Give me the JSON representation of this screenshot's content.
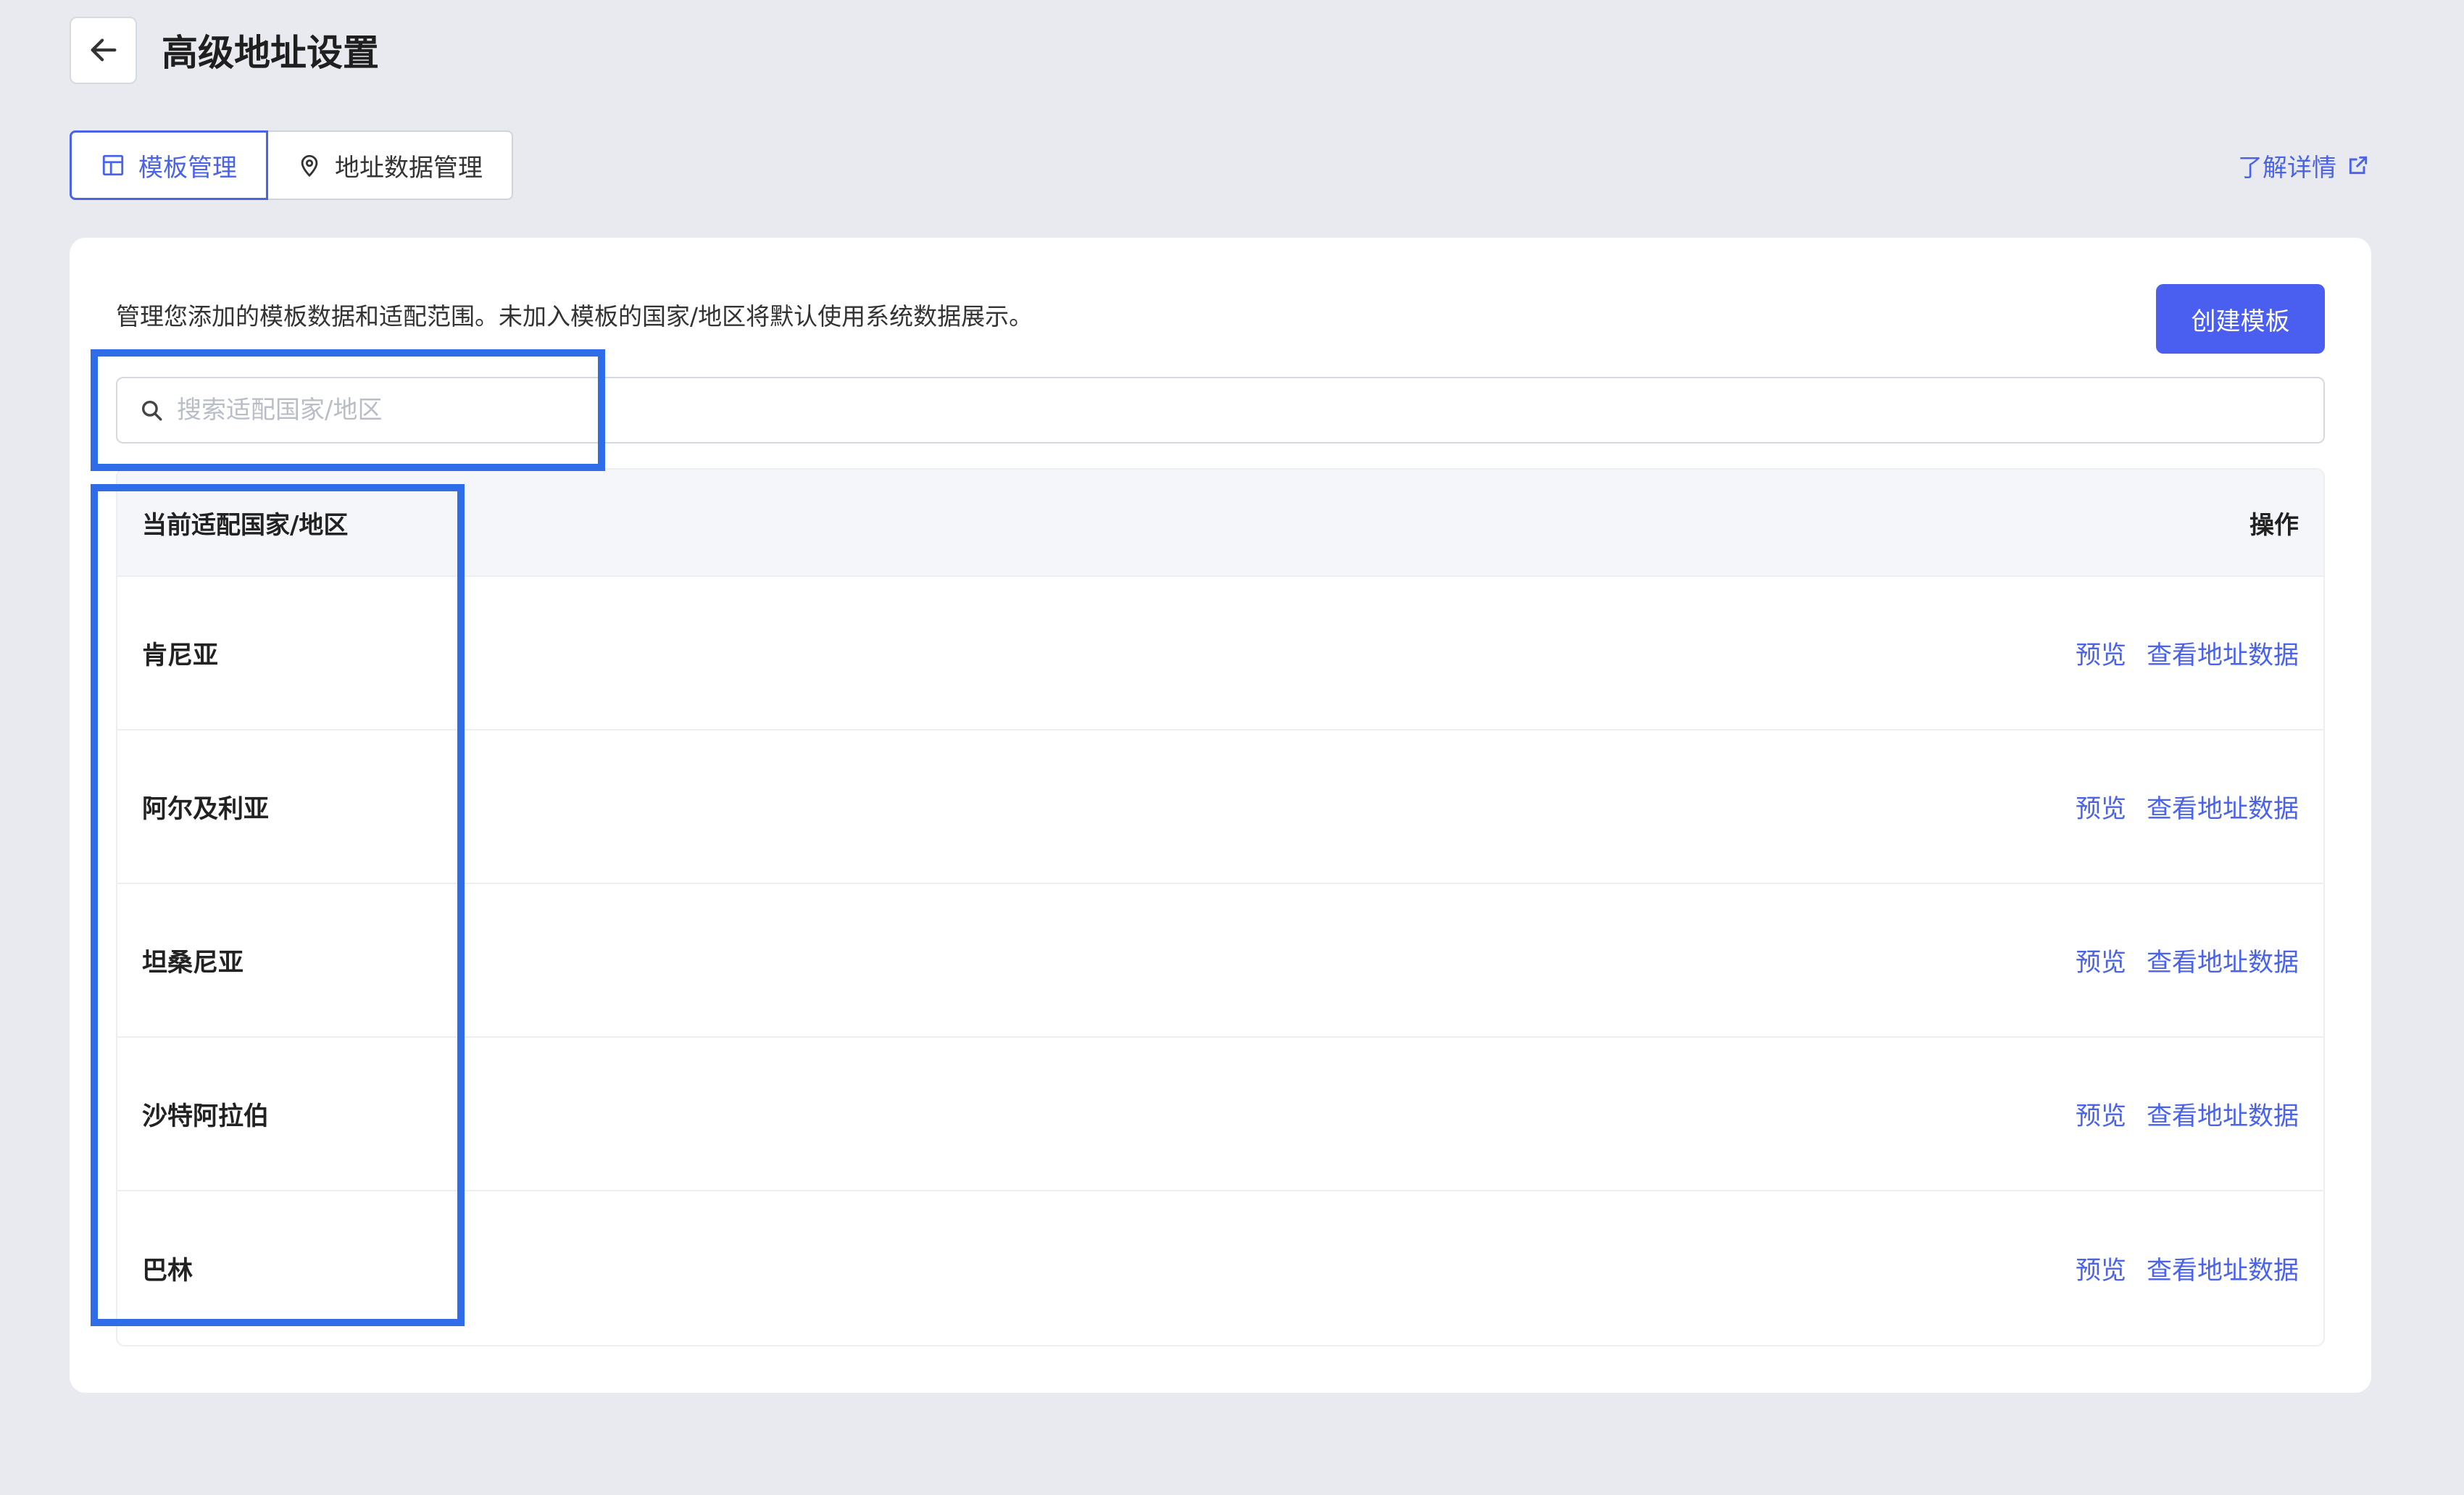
{
  "header": {
    "title": "高级地址设置"
  },
  "tabs": [
    {
      "label": "模板管理",
      "icon": "template-icon",
      "active": true
    },
    {
      "label": "地址数据管理",
      "icon": "location-pin-icon",
      "active": false
    }
  ],
  "learn_more": {
    "label": "了解详情",
    "icon": "external-link-icon"
  },
  "card": {
    "description": "管理您添加的模板数据和适配范围。未加入模板的国家/地区将默认使用系统数据展示。",
    "create_button": "创建模板",
    "search": {
      "placeholder": "搜索适配国家/地区",
      "value": ""
    }
  },
  "table": {
    "columns": {
      "country": "当前适配国家/地区",
      "actions": "操作"
    },
    "rows": [
      {
        "country": "肯尼亚",
        "preview": "预览",
        "view_data": "查看地址数据"
      },
      {
        "country": "阿尔及利亚",
        "preview": "预览",
        "view_data": "查看地址数据"
      },
      {
        "country": "坦桑尼亚",
        "preview": "预览",
        "view_data": "查看地址数据"
      },
      {
        "country": "沙特阿拉伯",
        "preview": "预览",
        "view_data": "查看地址数据"
      },
      {
        "country": "巴林",
        "preview": "预览",
        "view_data": "查看地址数据"
      }
    ]
  },
  "colors": {
    "accent": "#4a63e8",
    "button": "#4a5ef0",
    "highlight": "#2f6ce8",
    "background": "#e8eaef"
  }
}
